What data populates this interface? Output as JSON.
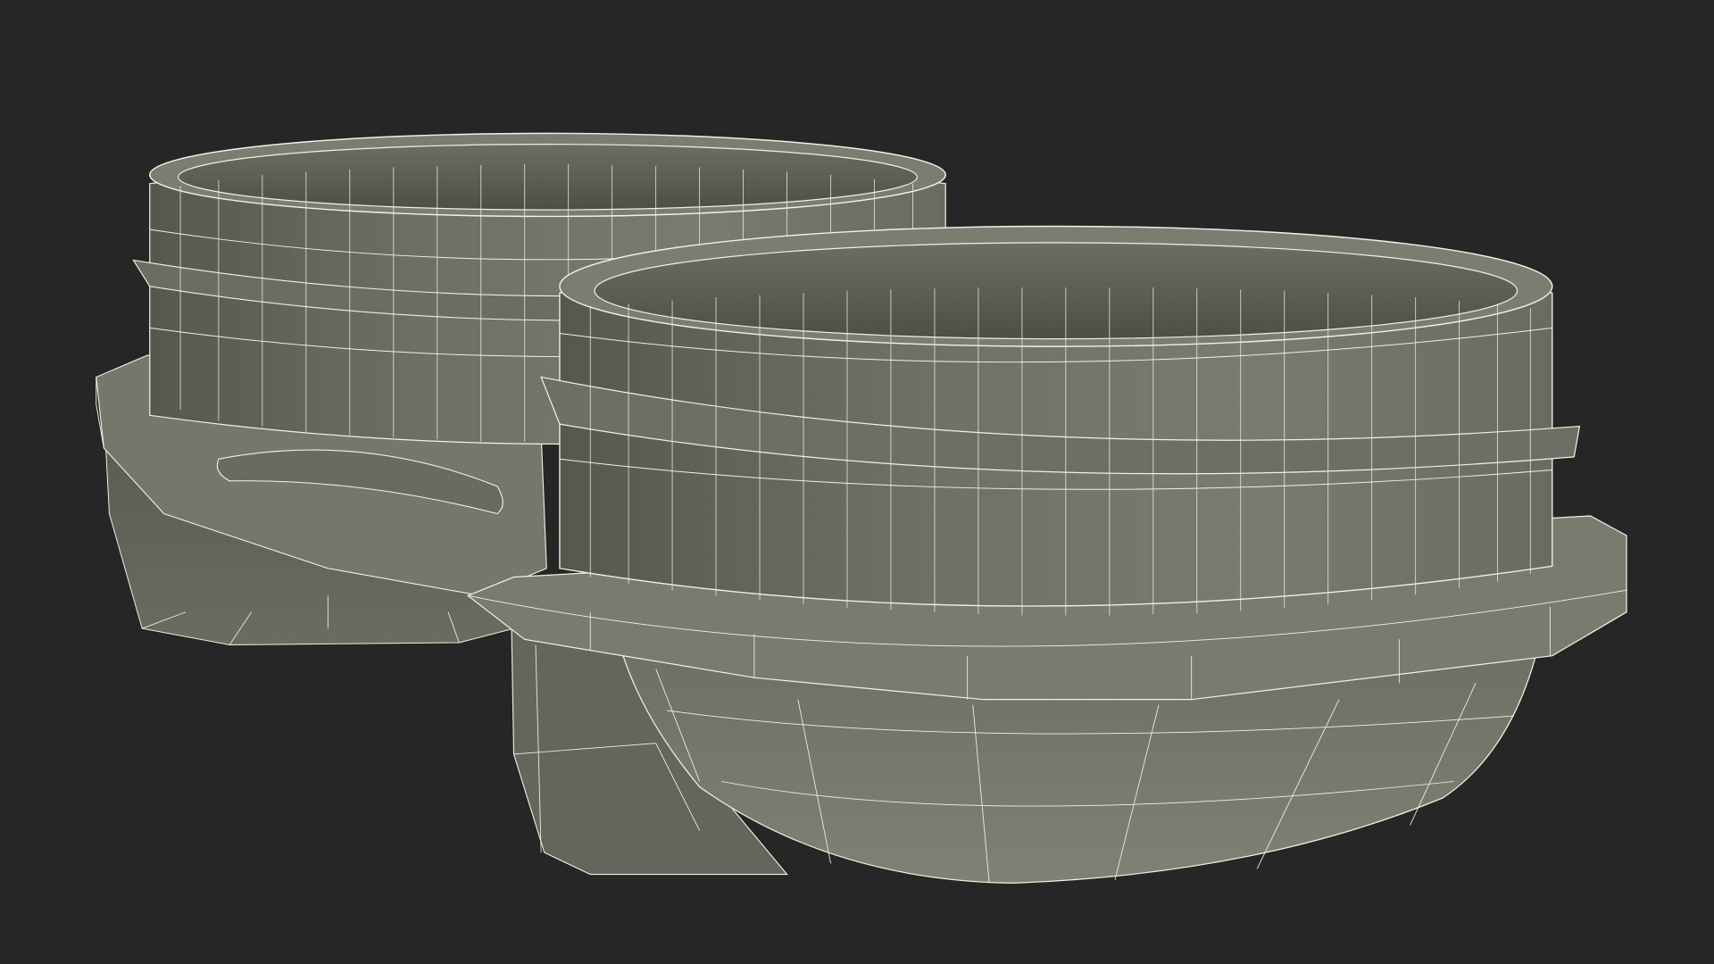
{
  "scene": {
    "subject": "wireframe-render",
    "background_color": "#262626",
    "surface_color": "#7c7d70",
    "surface_dark_color": "#5e5f55",
    "surface_shadow_color": "#4a4b43",
    "wire_color": "#f2f1e2"
  }
}
